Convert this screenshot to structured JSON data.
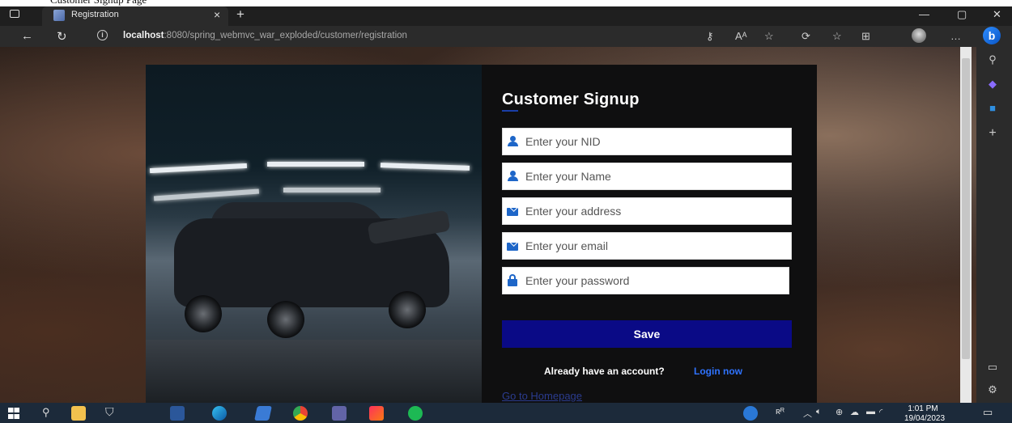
{
  "caption": "Customer Signup Page",
  "browser": {
    "tab_title": "Registration",
    "url_host": "localhost",
    "url_rest": ":8080/spring_webmvc_war_exploded/customer/registration"
  },
  "form": {
    "title": "Customer Signup",
    "fields": [
      {
        "placeholder": "Enter your NID",
        "icon": "person-icon"
      },
      {
        "placeholder": "Enter your Name",
        "icon": "person-icon"
      },
      {
        "placeholder": "Enter your address",
        "icon": "mail-icon"
      },
      {
        "placeholder": "Enter your email",
        "icon": "mail-icon"
      },
      {
        "placeholder": "Enter your password",
        "icon": "lock-icon"
      }
    ],
    "save_label": "Save",
    "account_prompt": "Already have an account?",
    "login_label": "Login now",
    "home_label": "Go to Homepage"
  },
  "taskbar": {
    "time": "1:01 PM",
    "date": "19/04/2023"
  },
  "colors": {
    "primary_button": "#0a0a86",
    "icon_blue": "#1e66c8",
    "link_blue": "#2f73ff"
  }
}
